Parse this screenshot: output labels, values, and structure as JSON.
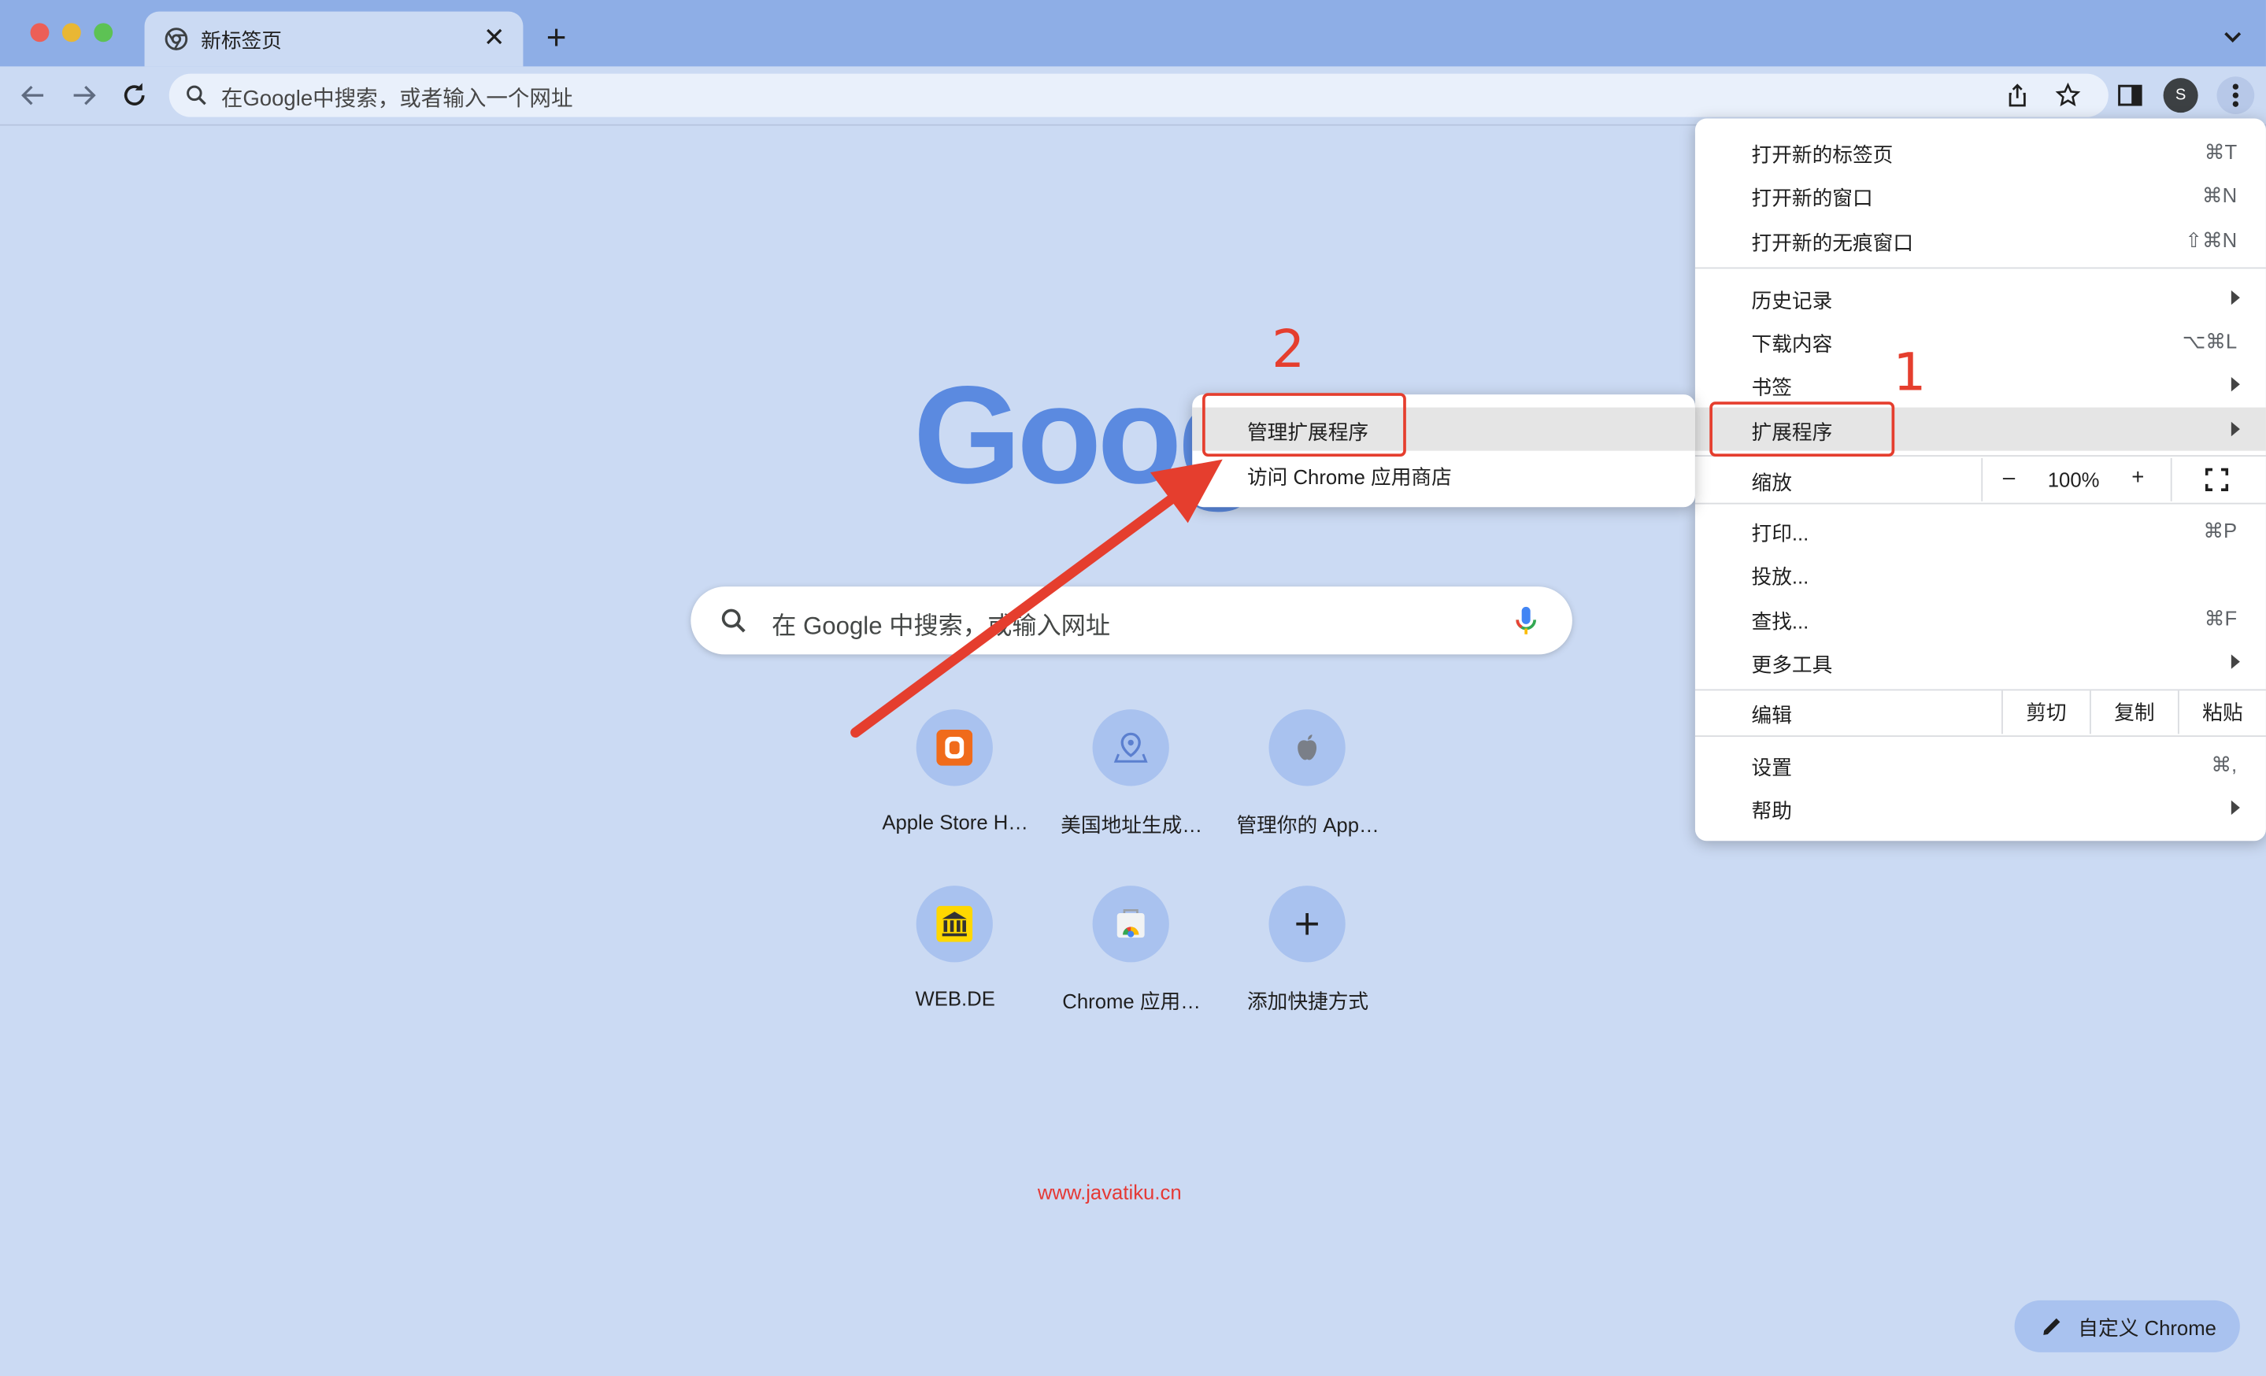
{
  "window": {
    "tab_title": "新标签页",
    "tab_close": "✕",
    "new_tab": "+",
    "profile_initial": "S"
  },
  "toolbar": {
    "omnibox_placeholder": "在Google中搜索，或者输入一个网址"
  },
  "ntp": {
    "logo": "Goog",
    "search_placeholder": "在 Google 中搜索，或输入网址",
    "shortcuts": [
      {
        "label": "Apple Store H…",
        "icon": "apple-store-icon"
      },
      {
        "label": "美国地址生成…",
        "icon": "map-pin-icon"
      },
      {
        "label": "管理你的 App…",
        "icon": "apple-icon"
      },
      {
        "label": "WEB.DE",
        "icon": "webde-icon"
      },
      {
        "label": "Chrome 应用…",
        "icon": "chrome-store-icon"
      },
      {
        "label": "添加快捷方式",
        "icon": "plus-icon"
      }
    ],
    "watermark": "www.javatiku.cn",
    "customize_label": "自定义 Chrome"
  },
  "menu": {
    "items": [
      {
        "label": "打开新的标签页",
        "shortcut": "⌘T"
      },
      {
        "label": "打开新的窗口",
        "shortcut": "⌘N"
      },
      {
        "label": "打开新的无痕窗口",
        "shortcut": "⇧⌘N"
      },
      {
        "label": "历史记录",
        "shortcut": ""
      },
      {
        "label": "下载内容",
        "shortcut": "⌥⌘L"
      },
      {
        "label": "书签",
        "shortcut": ""
      },
      {
        "label": "扩展程序",
        "shortcut": ""
      },
      {
        "label": "打印...",
        "shortcut": "⌘P"
      },
      {
        "label": "投放...",
        "shortcut": ""
      },
      {
        "label": "查找...",
        "shortcut": "⌘F"
      },
      {
        "label": "更多工具",
        "shortcut": ""
      },
      {
        "label": "设置",
        "shortcut": "⌘,"
      },
      {
        "label": "帮助",
        "shortcut": ""
      }
    ],
    "zoom": {
      "label": "缩放",
      "minus": "–",
      "value": "100%",
      "plus": "+"
    },
    "edit": {
      "label": "编辑",
      "cut": "剪切",
      "copy": "复制",
      "paste": "粘贴"
    }
  },
  "submenu": {
    "items": [
      {
        "label": "管理扩展程序"
      },
      {
        "label": "访问 Chrome 应用商店"
      }
    ]
  },
  "annotations": {
    "step1": "1",
    "step2": "2",
    "color": "#e53e2e"
  }
}
